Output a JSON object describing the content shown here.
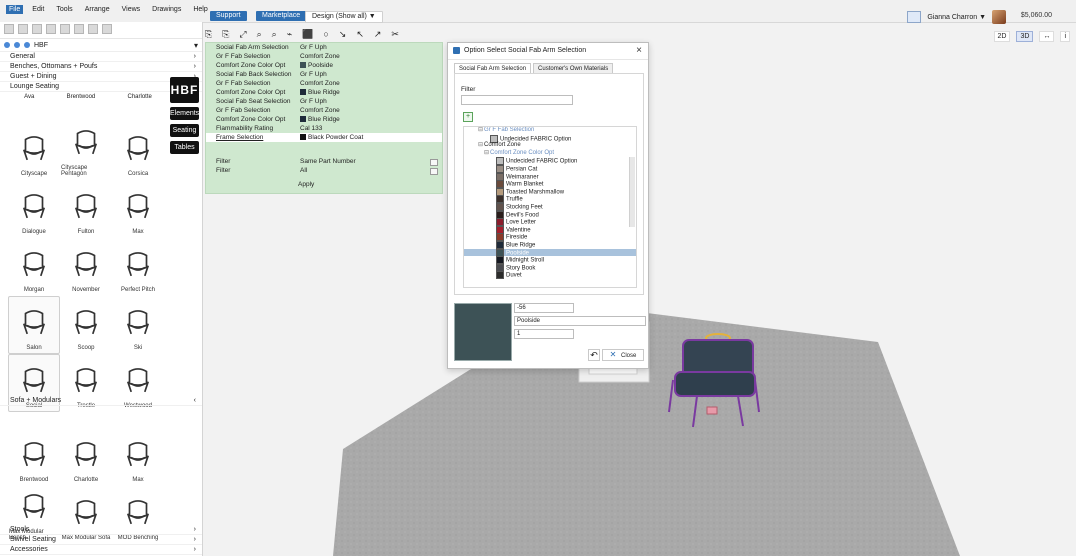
{
  "menus": [
    "File",
    "Edit",
    "Tools",
    "Arrange",
    "Views",
    "Drawings",
    "Help"
  ],
  "topbar": {
    "support": "Support",
    "marketplace": "Marketplace",
    "design": "Design (Show all) ▼",
    "user": "Gianna Charron ▼",
    "money": "$5,060.00"
  },
  "view_toggle": {
    "two_d": "2D",
    "three_d": "3D",
    "arrows": "↔",
    "info": "i"
  },
  "left_panel": {
    "hbf_code": "HBF",
    "side_brand": "HBF",
    "categories": [
      "General",
      "Benches, Ottomans + Poufs",
      "Guest + Dining",
      "Lounge Seating"
    ],
    "category_arrows": [
      "›",
      "›",
      "›",
      "‹"
    ],
    "lounge_headers": [
      "Ava",
      "Brentwood",
      "Charlotte"
    ],
    "tiles_lounge": [
      "Cityscape",
      "Cityscape Pentagon",
      "Corsica",
      "Dialogue",
      "Fulton",
      "Max",
      "Morgan",
      "November",
      "Perfect Pitch",
      "Salon",
      "Scoop",
      "Ski",
      "Social",
      "Trestle",
      "Westwood"
    ],
    "sofa_cat": "Sofa + Modulars",
    "sofa_tiles": [
      "Brentwood",
      "Charlotte",
      "Max",
      "Max Modular Bench",
      "Max Modular Sofa",
      "MOD Benching"
    ],
    "bottom_cats": [
      "Stools",
      "Swivel Seating",
      "Accessories"
    ],
    "side_tabs": [
      "Elements",
      "Seating",
      "Tables"
    ]
  },
  "props": {
    "rows": [
      {
        "k": "Social Fab Arm Selection",
        "v": "Gr F Uph",
        "swatch": ""
      },
      {
        "k": "Gr F Fab Selection",
        "v": "Comfort Zone",
        "swatch": ""
      },
      {
        "k": "Comfort Zone Color Opt",
        "v": "Poolside",
        "swatch": "#3d5256"
      },
      {
        "k": "Social Fab Back Selection",
        "v": "Gr F Uph",
        "swatch": ""
      },
      {
        "k": "Gr F Fab Selection",
        "v": "Comfort Zone",
        "swatch": ""
      },
      {
        "k": "Comfort Zone Color Opt",
        "v": "Blue Ridge",
        "swatch": "#1f2b3a"
      },
      {
        "k": "Social Fab Seat Selection",
        "v": "Gr F Uph",
        "swatch": ""
      },
      {
        "k": "Gr F Fab Selection",
        "v": "Comfort Zone",
        "swatch": ""
      },
      {
        "k": "Comfort Zone Color Opt",
        "v": "Blue Ridge",
        "swatch": "#1f2b3a"
      },
      {
        "k": "Flammability Rating",
        "v": "Cal 133",
        "swatch": ""
      },
      {
        "k": "Frame Selection",
        "v": "Black Powder Coat",
        "swatch": "#111111"
      }
    ],
    "filters": [
      {
        "k": "Filter",
        "v": "Same Part Number"
      },
      {
        "k": "Filter",
        "v": "All"
      }
    ],
    "apply": "Apply"
  },
  "dialog": {
    "title": "Option Select Social Fab Arm Selection",
    "tabs": [
      "Social Fab Arm Selection",
      "Customer's Own Materials"
    ],
    "filter_label": "Filter",
    "plus": "+",
    "tree": [
      {
        "indent": 14,
        "exp": "⊟",
        "label": "Gr F Fab Selection",
        "swatch": "",
        "color": "#6b8fc1",
        "sel": false
      },
      {
        "indent": 20,
        "exp": "",
        "label": "Undecided FABRIC Option",
        "swatch": "#bdbdbd",
        "color": "",
        "sel": false
      },
      {
        "indent": 14,
        "exp": "⊟",
        "label": "Comfort Zone",
        "swatch": "",
        "color": "",
        "sel": false
      },
      {
        "indent": 20,
        "exp": "⊟",
        "label": "Comfort Zone Color Opt",
        "swatch": "",
        "color": "#6b8fc1",
        "sel": false
      },
      {
        "indent": 26,
        "exp": "",
        "label": "Undecided FABRIC Option",
        "swatch": "#bdbdbd",
        "color": "",
        "sel": false
      },
      {
        "indent": 26,
        "exp": "",
        "label": "Persian Cat",
        "swatch": "#9b8f86",
        "color": "",
        "sel": false
      },
      {
        "indent": 26,
        "exp": "",
        "label": "Weimaraner",
        "swatch": "#7a6e66",
        "color": "",
        "sel": false
      },
      {
        "indent": 26,
        "exp": "",
        "label": "Warm Blanket",
        "swatch": "#6a4b3c",
        "color": "",
        "sel": false
      },
      {
        "indent": 26,
        "exp": "",
        "label": "Toasted Marshmallow",
        "swatch": "#b59b7d",
        "color": "",
        "sel": false
      },
      {
        "indent": 26,
        "exp": "",
        "label": "Truffle",
        "swatch": "#3b2f2a",
        "color": "",
        "sel": false
      },
      {
        "indent": 26,
        "exp": "",
        "label": "Stocking Feet",
        "swatch": "#61524c",
        "color": "",
        "sel": false
      },
      {
        "indent": 26,
        "exp": "",
        "label": "Devil's Food",
        "swatch": "#2a1e1b",
        "color": "",
        "sel": false
      },
      {
        "indent": 26,
        "exp": "",
        "label": "Love Letter",
        "swatch": "#8b1d2c",
        "color": "",
        "sel": false
      },
      {
        "indent": 26,
        "exp": "",
        "label": "Valentine",
        "swatch": "#a51f2d",
        "color": "",
        "sel": false
      },
      {
        "indent": 26,
        "exp": "",
        "label": "Fireside",
        "swatch": "#8b3b2a",
        "color": "",
        "sel": false
      },
      {
        "indent": 26,
        "exp": "",
        "label": "Blue Ridge",
        "swatch": "#1f2b3a",
        "color": "",
        "sel": false
      },
      {
        "indent": 26,
        "exp": "",
        "label": "Poolside",
        "swatch": "#3d5256",
        "color": "#ffffff",
        "sel": true
      },
      {
        "indent": 26,
        "exp": "",
        "label": "Midnight Stroll",
        "swatch": "#151820",
        "color": "",
        "sel": false
      },
      {
        "indent": 26,
        "exp": "",
        "label": "Story Book",
        "swatch": "#4a4b50",
        "color": "",
        "sel": false
      },
      {
        "indent": 26,
        "exp": "",
        "label": "Duvet",
        "swatch": "#2c2c2c",
        "color": "",
        "sel": false
      }
    ],
    "selected_number": "-56",
    "selected_name": "Poolside",
    "qty": "1",
    "close": "Close",
    "reset_icon": "↶"
  }
}
